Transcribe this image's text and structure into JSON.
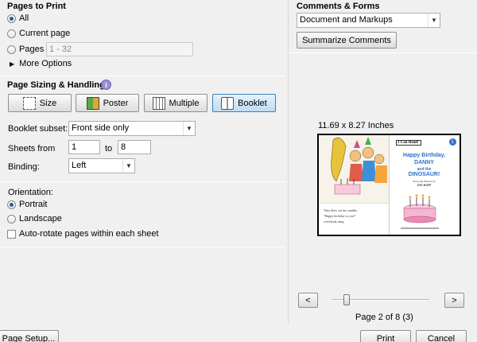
{
  "pages_to_print": {
    "title": "Pages to Print",
    "all_label": "All",
    "current_label": "Current page",
    "pages_label": "Pages",
    "pages_value": "1 - 32",
    "more_options_label": "More Options"
  },
  "sizing": {
    "title": "Page Sizing & Handling",
    "info_icon": "i",
    "buttons": {
      "size": "Size",
      "poster": "Poster",
      "multiple": "Multiple",
      "booklet": "Booklet"
    },
    "booklet_subset_label": "Booklet subset:",
    "booklet_subset_value": "Front side only",
    "sheets_from_label": "Sheets from",
    "sheets_from_value": "1",
    "sheets_to_label": "to",
    "sheets_to_value": "8",
    "binding_label": "Binding:",
    "binding_value": "Left"
  },
  "orientation": {
    "title": "Orientation:",
    "portrait_label": "Portrait",
    "landscape_label": "Landscape",
    "autorotate_label": "Auto-rotate pages within each sheet"
  },
  "comments": {
    "title": "Comments & Forms",
    "select_value": "Document and Markups",
    "summarize_label": "Summarize Comments"
  },
  "preview": {
    "dimensions": "11.69 x 8.27 Inches",
    "page_indicator": "Page 2 of 8 (3)",
    "prev_label": "<",
    "next_label": ">",
    "slider_level": 0.12,
    "book_right_badge": "I Can Read!",
    "book_right_title_1": "Happy Birthday,",
    "book_right_title_2": "DANNY",
    "book_right_title_3": "and the",
    "book_right_title_4": "DINOSAUR!",
    "book_right_author_1": "Story and Pictures by",
    "book_right_author_2": "SYD HOFF",
    "book_left_text_1": "They blew out the candles.",
    "book_left_text_2": "\"Happy birthday to you!\"",
    "book_left_text_3": "everybody sang."
  },
  "footer": {
    "page_setup_label": "Page Setup...",
    "print_label": "Print",
    "cancel_label": "Cancel"
  },
  "colors": {
    "accent_blue": "#2a5aa8",
    "book_title_blue": "#2f6fcc",
    "book_title_pink": "#d94b8a"
  }
}
